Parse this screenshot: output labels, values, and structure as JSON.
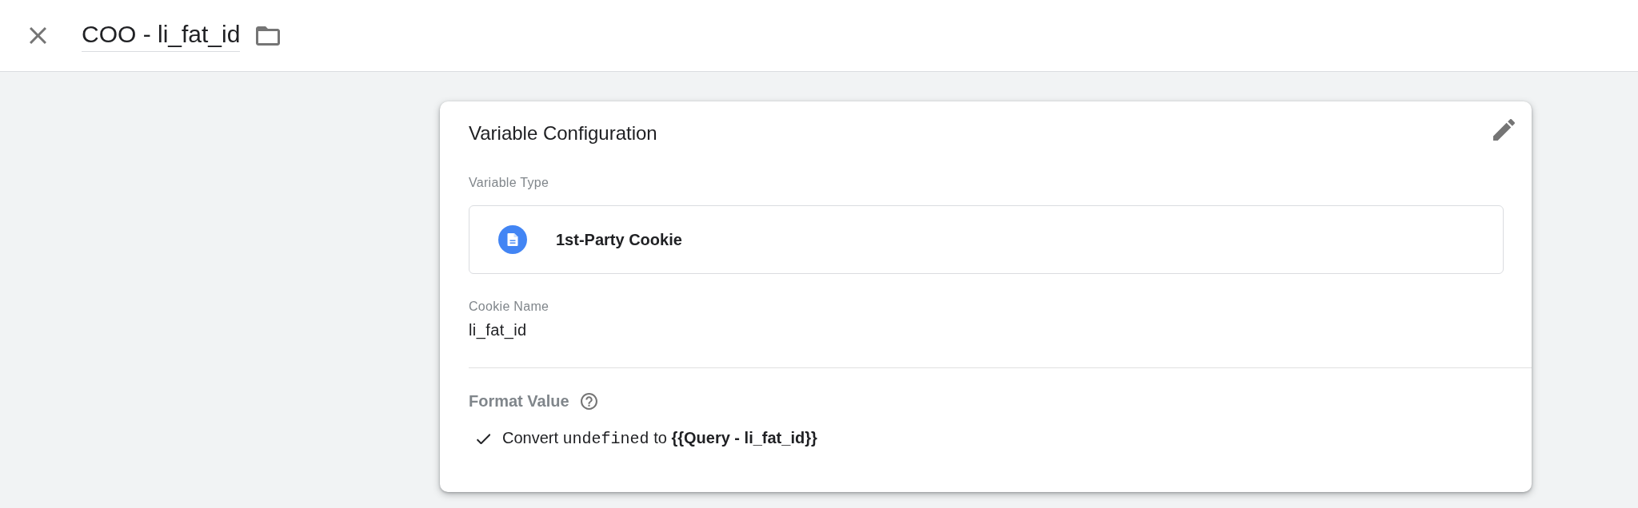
{
  "header": {
    "title": "COO - li_fat_id"
  },
  "card": {
    "title": "Variable Configuration",
    "variable_type": {
      "label": "Variable Type",
      "value": "1st-Party Cookie"
    },
    "cookie_name": {
      "label": "Cookie Name",
      "value": "li_fat_id"
    },
    "format_value": {
      "label": "Format Value",
      "options": [
        {
          "checked": true,
          "prefix": "Convert",
          "code": "undefined",
          "suffix": "to **{{Query - li_fat_id}}**"
        }
      ]
    }
  }
}
